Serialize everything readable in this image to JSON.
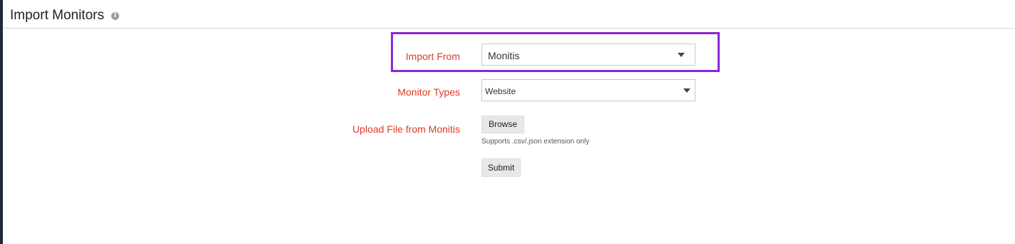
{
  "header": {
    "title": "Import Monitors",
    "info_icon": "info-icon"
  },
  "form": {
    "import_from": {
      "label": "Import From",
      "value": "Monitis"
    },
    "monitor_types": {
      "label": "Monitor Types",
      "value": "Website"
    },
    "upload": {
      "label": "Upload File from Monitis",
      "browse_label": "Browse",
      "hint": "Supports .csv/.json extension only"
    },
    "submit_label": "Submit"
  },
  "colors": {
    "label": "#dd3b2a",
    "highlight": "#8a27d6"
  }
}
